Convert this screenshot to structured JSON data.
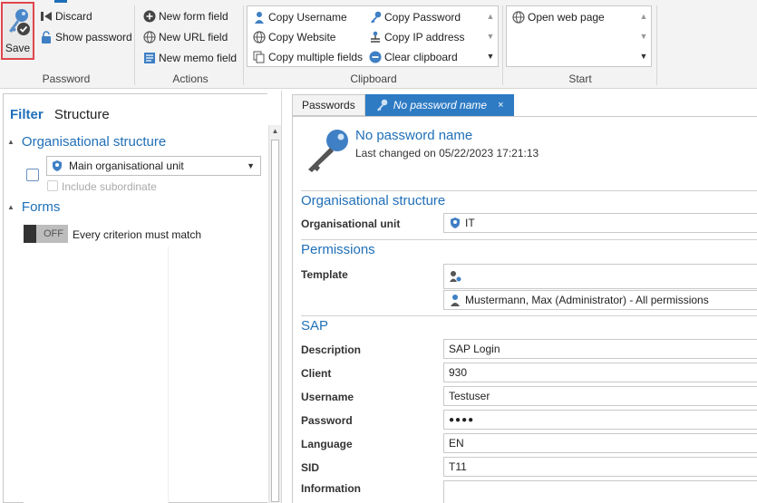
{
  "ribbon": {
    "save_label": "Save",
    "discard_label": "Discard",
    "show_password_label": "Show password",
    "password_group": "Password",
    "new_form_field": "New form field",
    "new_url_field": "New URL field",
    "new_memo_field": "New memo field",
    "actions_group": "Actions",
    "copy_username": "Copy Username",
    "copy_website": "Copy Website",
    "copy_multiple_fields": "Copy multiple fields",
    "copy_password": "Copy Password",
    "copy_ip_address": "Copy IP address",
    "clear_clipboard": "Clear clipboard",
    "clipboard_group": "Clipboard",
    "open_web_page": "Open web page",
    "start_group": "Start"
  },
  "left": {
    "filter_tab": "Filter",
    "structure_tab": "Structure",
    "org_section": "Organisational structure",
    "org_combo": "Main organisational unit",
    "include_subordinate": "Include subordinate",
    "forms_section": "Forms",
    "toggle_state": "OFF",
    "toggle_label": "Every criterion must match"
  },
  "right": {
    "tabs": {
      "passwords": "Passwords",
      "active": "No password name",
      "close": "×"
    },
    "record_title": "No password name",
    "last_changed": "Last changed on 05/22/2023 17:21:13",
    "org_section": "Organisational structure",
    "org_unit_label": "Organisational unit",
    "org_unit_value": "IT",
    "permissions_section": "Permissions",
    "template_label": "Template",
    "template_value": "",
    "permission_value": "Mustermann, Max (Administrator) - All permissions",
    "sap_section": "SAP",
    "fields": {
      "description": {
        "label": "Description",
        "value": "SAP Login"
      },
      "client": {
        "label": "Client",
        "value": "930"
      },
      "username": {
        "label": "Username",
        "value": "Testuser"
      },
      "password": {
        "label": "Password",
        "value": "●●●●"
      },
      "language": {
        "label": "Language",
        "value": "EN"
      },
      "sid": {
        "label": "SID",
        "value": "T11"
      },
      "information": {
        "label": "Information",
        "value": ""
      }
    }
  },
  "colors": {
    "accent": "#1f6fb8",
    "tab_active": "#2e7bc4",
    "save_highlight": "#e0474c"
  }
}
